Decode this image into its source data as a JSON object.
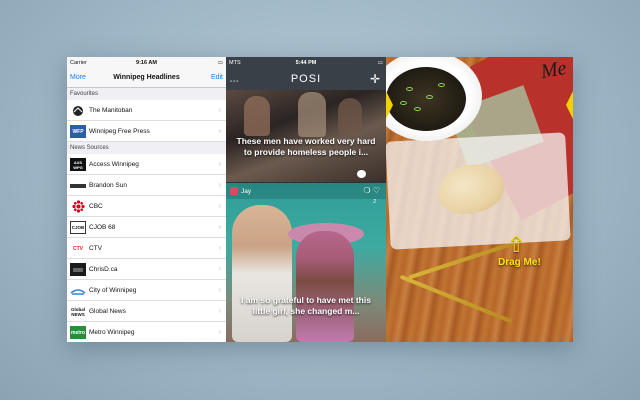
{
  "news_app": {
    "status": {
      "carrier": "Carrier",
      "time": "9:16 AM"
    },
    "nav": {
      "left": "More",
      "title": "Winnipeg Headlines",
      "right": "Edit"
    },
    "favourites_header": "Favourites",
    "favourites": [
      {
        "label": "The Manitoban",
        "logo": ""
      },
      {
        "label": "Winnipeg Free Press",
        "logo": "WFP"
      }
    ],
    "sources_header": "News Sources",
    "sources": [
      {
        "label": "Access Winnipeg",
        "logo": "AXS WPG"
      },
      {
        "label": "Brandon Sun",
        "logo": ""
      },
      {
        "label": "CBC",
        "logo": ""
      },
      {
        "label": "CJOB 68",
        "logo": "CJOB"
      },
      {
        "label": "CTV",
        "logo": "CTV"
      },
      {
        "label": "ChrisD.ca",
        "logo": ""
      },
      {
        "label": "City of Winnipeg",
        "logo": ""
      },
      {
        "label": "Global News",
        "logo": "Global NEWS"
      },
      {
        "label": "Metro Winnipeg",
        "logo": "metro"
      }
    ]
  },
  "posi_app": {
    "status": {
      "carrier": "MTS",
      "time": "5:44 PM"
    },
    "brand": "POSI",
    "posts": [
      {
        "caption": "These men have worked very hard to provide homeless people i..."
      },
      {
        "user": "Jay",
        "likes": "2",
        "caption": "I am so grateful to have met this little girl, she changed m..."
      }
    ]
  },
  "cookie_app": {
    "mat_text": "Me",
    "hint": "Drag Me!"
  }
}
